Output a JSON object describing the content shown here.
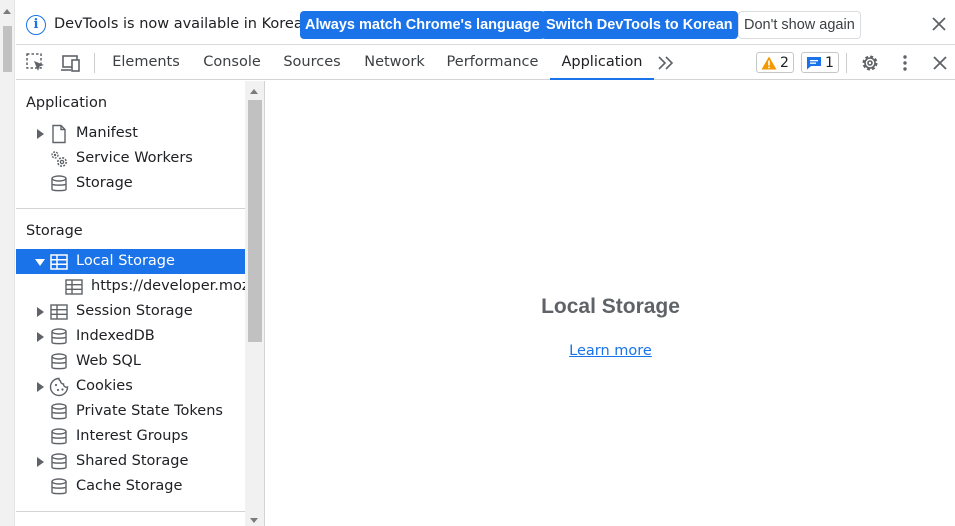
{
  "infobar": {
    "message": "DevTools is now available in Korean!",
    "match_language_label": "Always match Chrome's language",
    "switch_label": "Switch DevTools to Korean",
    "dismiss_label": "Don't show again"
  },
  "toolbar": {
    "tabs": [
      {
        "label": "Elements"
      },
      {
        "label": "Console"
      },
      {
        "label": "Sources"
      },
      {
        "label": "Network"
      },
      {
        "label": "Performance"
      },
      {
        "label": "Application",
        "active": true
      }
    ],
    "warnings_count": "2",
    "messages_count": "1"
  },
  "sidebar": {
    "application_title": "Application",
    "application_items": [
      {
        "label": "Manifest",
        "icon": "document-icon",
        "expandable": true
      },
      {
        "label": "Service Workers",
        "icon": "gears-icon",
        "expandable": false
      },
      {
        "label": "Storage",
        "icon": "database-icon",
        "expandable": false
      }
    ],
    "storage_title": "Storage",
    "storage_items": [
      {
        "label": "Local Storage",
        "icon": "table-icon",
        "expandable": true,
        "expanded": true,
        "selected": true
      },
      {
        "label": "https://developer.mozil",
        "icon": "table-icon",
        "child": true
      },
      {
        "label": "Session Storage",
        "icon": "table-icon",
        "expandable": true
      },
      {
        "label": "IndexedDB",
        "icon": "database-icon",
        "expandable": true
      },
      {
        "label": "Web SQL",
        "icon": "database-icon",
        "expandable": false
      },
      {
        "label": "Cookies",
        "icon": "cookie-icon",
        "expandable": true
      },
      {
        "label": "Private State Tokens",
        "icon": "database-icon",
        "expandable": false
      },
      {
        "label": "Interest Groups",
        "icon": "database-icon",
        "expandable": false
      },
      {
        "label": "Shared Storage",
        "icon": "database-icon",
        "expandable": true
      },
      {
        "label": "Cache Storage",
        "icon": "database-icon",
        "expandable": false
      }
    ]
  },
  "main": {
    "title": "Local Storage",
    "learn_more": "Learn more"
  },
  "colors": {
    "accent": "#1a73e8",
    "warning": "#f29900",
    "text": "#202124"
  }
}
